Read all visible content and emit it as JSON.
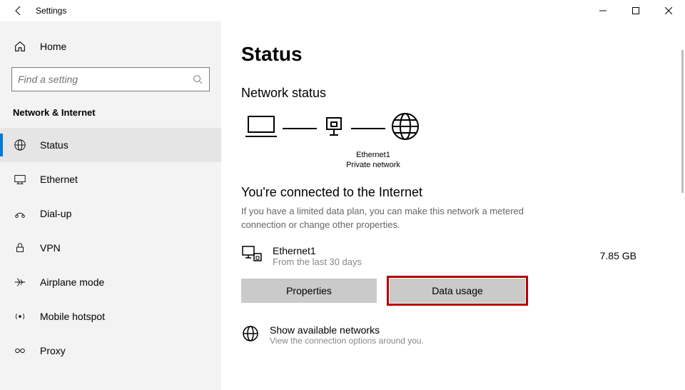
{
  "window": {
    "title": "Settings"
  },
  "sidebar": {
    "home": "Home",
    "searchPlaceholder": "Find a setting",
    "section": "Network & Internet",
    "items": [
      {
        "label": "Status"
      },
      {
        "label": "Ethernet"
      },
      {
        "label": "Dial-up"
      },
      {
        "label": "VPN"
      },
      {
        "label": "Airplane mode"
      },
      {
        "label": "Mobile hotspot"
      },
      {
        "label": "Proxy"
      }
    ]
  },
  "main": {
    "pageTitle": "Status",
    "networkStatus": "Network status",
    "diagram": {
      "adapter": "Ethernet1",
      "scope": "Private network"
    },
    "connectedTitle": "You're connected to the Internet",
    "connectedDesc": "If you have a limited data plan, you can make this network a metered connection or change other properties.",
    "connection": {
      "name": "Ethernet1",
      "period": "From the last 30 days",
      "usage": "7.85 GB"
    },
    "buttons": {
      "properties": "Properties",
      "dataUsage": "Data usage"
    },
    "available": {
      "title": "Show available networks",
      "subtitle": "View the connection options around you."
    }
  }
}
